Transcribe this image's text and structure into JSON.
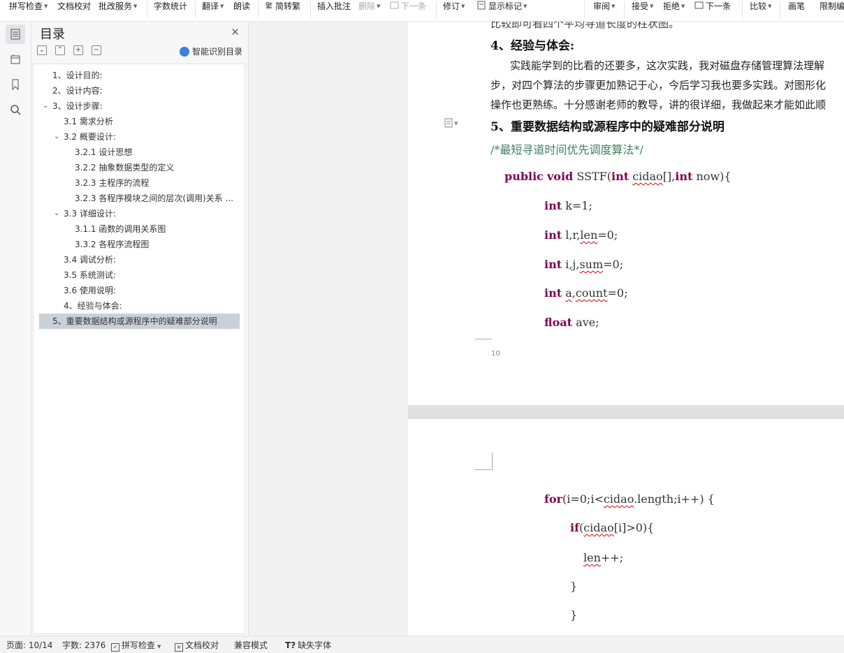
{
  "toolbar": {
    "items": [
      {
        "label": "拼写检查",
        "caret": true
      },
      {
        "label": "文档校对",
        "caret": false
      },
      {
        "label": "批改服务",
        "caret": true
      },
      {
        "label": "字数统计",
        "caret": false
      },
      {
        "label": "翻译",
        "caret": true
      },
      {
        "label": "朗读",
        "caret": false
      },
      {
        "label": "简转繁",
        "caret": false
      },
      {
        "label": "插入批注",
        "caret": false
      },
      {
        "label": "删除",
        "caret": true
      },
      {
        "label": "下一条",
        "caret": false
      },
      {
        "label": "修订",
        "caret": true
      },
      {
        "label": "显示标记",
        "caret": true
      },
      {
        "label": "审阅",
        "caret": true
      },
      {
        "label": "接受",
        "caret": true
      },
      {
        "label": "拒绝",
        "caret": true
      },
      {
        "label": "下一条",
        "caret": false
      },
      {
        "label": "比较",
        "caret": true
      },
      {
        "label": "画笔",
        "caret": false
      },
      {
        "label": "限制编"
      }
    ]
  },
  "nav": {
    "title": "目录",
    "smart_label": "智能识别目录",
    "toc": [
      {
        "label": "1、设计目的:"
      },
      {
        "label": "2、设计内容:"
      },
      {
        "label": "3、设计步骤:"
      },
      {
        "label": "3.1 需求分析"
      },
      {
        "label": "3.2  概要设计:"
      },
      {
        "label": "3.2.1  设计思想"
      },
      {
        "label": "3.2.2  抽象数据类型的定义"
      },
      {
        "label": "3.2.3  主程序的流程"
      },
      {
        "label": "3.2.3  各程序模块之间的层次(调用)关系 ..."
      },
      {
        "label": "3.3 详细设计:"
      },
      {
        "label": "3.1.1  函数的调用关系图"
      },
      {
        "label": "3.3.2 各程序流程图"
      },
      {
        "label": "3.4 调试分析:"
      },
      {
        "label": "3.5  系统测试:"
      },
      {
        "label": "3.6  使用说明:"
      },
      {
        "label": "4、经验与体会:"
      },
      {
        "label": "5、重要数据结构或源程序中的疑难部分说明"
      }
    ]
  },
  "doc": {
    "line_top": "比较即可看四个平均寻道长度的柱状图。",
    "heading4": "4、经验与体会:",
    "para1": "实践能学到的比看的还要多，这次实践，我对磁盘存储管理算法理解",
    "para2": "步，对四个算法的步骤更加熟记于心，今后学习我也要多实践。对图形化",
    "para3": "操作也更熟练。十分感谢老师的教导，讲的很详细，我做起来才能如此顺",
    "heading5": "5、重要数据结构或源程序中的疑难部分说明",
    "comment": "/*最短寻道时间优先调度算法*/",
    "sig": {
      "kw1": "public",
      "kw2": "void",
      "name": "SSTF(",
      "kw3": "int",
      "p1": "cidao",
      "mid": "[],",
      "kw4": "int",
      "p2": " now){"
    },
    "l1": {
      "kw": "int",
      "rest": " k=1;"
    },
    "l2": {
      "kw": "int",
      "a": "  l,r,",
      "b": "len",
      "c": "=0;"
    },
    "l3": {
      "kw": "int",
      "a": " i,j,",
      "b": "sum",
      "c": "=0;"
    },
    "l4": {
      "kw": "int",
      "a": " ",
      "b": "a",
      "c": ",",
      "d": "count",
      "e": "=0;"
    },
    "l5": {
      "kw": "float",
      "rest": " ave;"
    },
    "page_num": "10",
    "p2l1": {
      "kw": "for",
      "a": "(i=0;i<",
      "b": "cidao",
      "c": ".length;i++)   {"
    },
    "p2l2": {
      "kw": "if",
      "a": "(",
      "b": "cidao",
      "c": "[i]>0){"
    },
    "p2l3": {
      "b": "len",
      "c": "++;"
    },
    "p2l4": "}",
    "p2l5": "}"
  },
  "status": {
    "page": "页面: 10/14",
    "words": "字数: 2376",
    "spell": "拼写检查",
    "proof": "文档校对",
    "compat": "兼容模式",
    "font_missing": "缺失字体"
  }
}
